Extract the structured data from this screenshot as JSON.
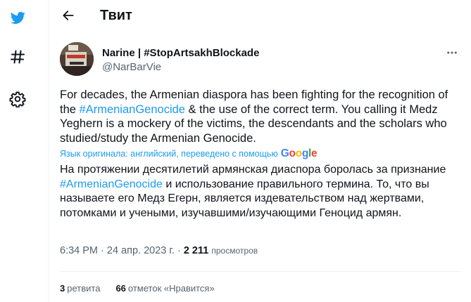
{
  "sidebar": {
    "items": [
      {
        "icon": "twitter-bird-icon"
      },
      {
        "icon": "hashtag-icon"
      },
      {
        "icon": "gear-icon"
      }
    ]
  },
  "header": {
    "title": "Твит"
  },
  "tweet": {
    "author_name": "Narine | #StopArtsakhBlockade",
    "author_handle": "@NarBarVie",
    "text_en_1": "For decades, the Armenian diaspora has been fighting for the recognition of the ",
    "hashtag": "#ArmenianGenocide",
    "text_en_2": " & the use of the correct term. You calling it Medz Yeghern is a mockery of the victims, the descendants and the scholars who studied/study the Armenian Genocide.",
    "translation_note": "Язык оригинала: английский, переведено с помощью",
    "translation_provider": "Google",
    "text_ru_1": "На протяжении десятилетий армянская диаспора боролась за признание ",
    "text_ru_2": " и использование правильного термина. То, что вы называете его Медз Егерн, является издевательством над жертвами, потомками и учеными, изучавшими/изучающими Геноцид армян.",
    "time": "6:34 PM · 24 апр. 2023 г. · ",
    "views_count": "2 211",
    "views_label": "просмотров",
    "retweets_count": "3",
    "retweets_label": "ретвита",
    "likes_count": "66",
    "likes_label": "отметок «Нравится»"
  },
  "colors": {
    "accent": "#1d9bf0",
    "text": "#0f1419",
    "muted": "#536471"
  }
}
